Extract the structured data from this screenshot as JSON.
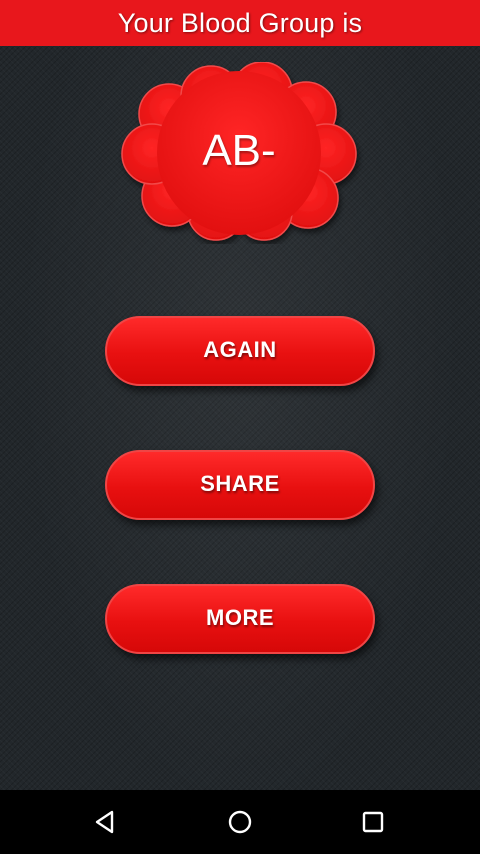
{
  "header": {
    "title": "Your Blood Group is"
  },
  "result": {
    "blood_group": "AB-"
  },
  "buttons": {
    "again": "AGAIN",
    "share": "SHARE",
    "more": "MORE"
  },
  "navbar": {
    "back_icon": "back-triangle-icon",
    "home_icon": "home-circle-icon",
    "recent_icon": "recent-apps-square-icon"
  },
  "colors": {
    "accent": "#e8171c",
    "background": "#22272b",
    "navbar": "#000000",
    "text": "#ffffff"
  }
}
